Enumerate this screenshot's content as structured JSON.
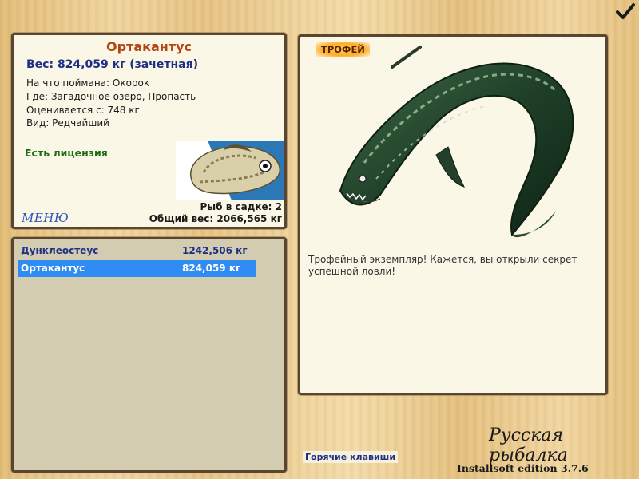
{
  "fish": {
    "name": "Ортакантус",
    "weight_line": "Вес: 824,059 кг (зачетная)",
    "caught_on": "На что поймана: Окорок",
    "location": "Где: Загадочное озеро, Пропасть",
    "value": "Оценивается с: 748 кг",
    "kind": "Вид: Редчайший",
    "license": "Есть лицензия"
  },
  "menu": {
    "label": "МЕНЮ"
  },
  "cage": {
    "count_text": "Рыб в садке: 2",
    "total_text": "Общий вес: 2066,565 кг",
    "items": [
      {
        "name": "Дунклеостеус",
        "weight": "1242,506 кг",
        "selected": false
      },
      {
        "name": "Ортакантус",
        "weight": "824,059 кг",
        "selected": true
      }
    ]
  },
  "trophy": {
    "badge": "ТРОФЕЙ",
    "description": "Трофейный экземпляр! Кажется, вы открыли секрет успешной ловли!"
  },
  "footer": {
    "hotkeys": "Горячие клавиши",
    "game_title": "Русская рыбалка",
    "edition": "Installsoft edition 3.7.6"
  },
  "icons": {
    "confirm": "check-icon",
    "thumbnail": "fish-thumbnail",
    "trophy_image": "orthacanthus-illustration"
  },
  "colors": {
    "selected_row": "#2e8cf2",
    "title": "#b24714",
    "weight": "#1f2f86",
    "license": "#1c6d17"
  }
}
